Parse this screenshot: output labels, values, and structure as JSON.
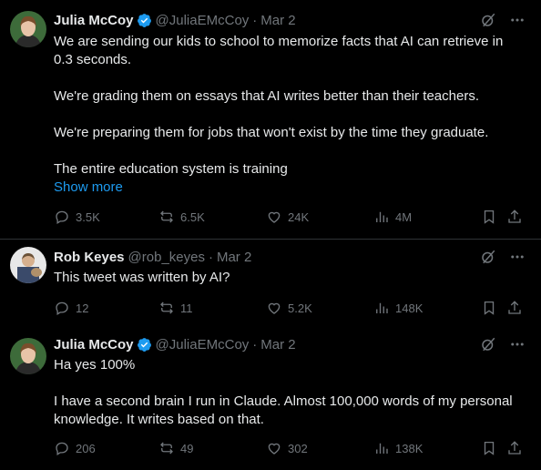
{
  "tweets": [
    {
      "author": {
        "name": "Julia McCoy",
        "handle": "@JuliaEMcCoy",
        "verified": true
      },
      "date": "Mar 2",
      "lines": [
        "We are sending our kids to school to memorize facts that AI can retrieve in",
        "0.3 seconds.",
        "",
        "We're grading them on essays that AI writes better than their teachers.",
        "",
        "We're preparing them for jobs that won't exist by the time they graduate.",
        "",
        "The entire education system is training"
      ],
      "show_more": "Show more",
      "stats": {
        "replies": "3.5K",
        "reposts": "6.5K",
        "likes": "24K",
        "views": "4M"
      }
    },
    {
      "author": {
        "name": "Rob Keyes",
        "handle": "@rob_keyes",
        "verified": false
      },
      "date": "Mar 2",
      "lines": [
        "This tweet was written by AI?"
      ],
      "stats": {
        "replies": "12",
        "reposts": "11",
        "likes": "5.2K",
        "views": "148K"
      }
    },
    {
      "author": {
        "name": "Julia McCoy",
        "handle": "@JuliaEMcCoy",
        "verified": true
      },
      "date": "Mar 2",
      "lines": [
        "Ha yes 100%",
        "",
        "I have a second brain I run in Claude. Almost 100,000 words of my personal",
        "knowledge. It writes based on that."
      ],
      "stats": {
        "replies": "206",
        "reposts": "49",
        "likes": "302",
        "views": "138K"
      }
    }
  ],
  "separator": "·",
  "colors": {
    "background": "#000000",
    "text": "#e7e9ea",
    "muted": "#71767b",
    "link": "#1d9bf0",
    "verified": "#1d9bf0"
  }
}
